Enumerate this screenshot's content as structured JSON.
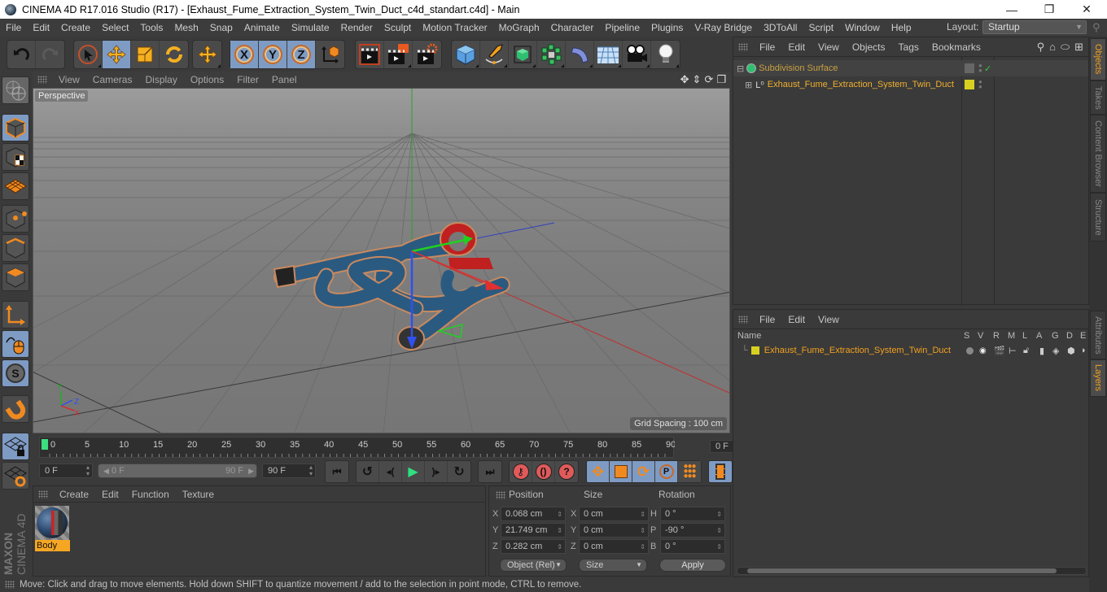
{
  "window": {
    "title": "CINEMA 4D R17.016 Studio (R17) - [Exhaust_Fume_Extraction_System_Twin_Duct_c4d_standart.c4d] - Main",
    "controls": {
      "minimize": "—",
      "maximize": "❐",
      "close": "✕"
    }
  },
  "menubar": {
    "items": [
      "File",
      "Edit",
      "Create",
      "Select",
      "Tools",
      "Mesh",
      "Snap",
      "Animate",
      "Simulate",
      "Render",
      "Sculpt",
      "Motion Tracker",
      "MoGraph",
      "Character",
      "Pipeline",
      "Plugins",
      "V-Ray Bridge",
      "3DToAll",
      "Script",
      "Window",
      "Help"
    ],
    "layout_label": "Layout:",
    "layout_value": "Startup"
  },
  "toolbar": {
    "undo": "undo-icon",
    "redo": "redo-icon",
    "tools": [
      "live-selection",
      "move",
      "scale",
      "rotate",
      "recent-tool"
    ],
    "axes": [
      "X",
      "Y",
      "Z"
    ],
    "render": [
      "render-view",
      "render-to-picture-viewer",
      "edit-render-settings"
    ],
    "objects": [
      "cube",
      "pen",
      "subdivision-surface",
      "cloner",
      "deformer",
      "floor",
      "camera",
      "light"
    ]
  },
  "viewport": {
    "menu": [
      "View",
      "Cameras",
      "Display",
      "Options",
      "Filter",
      "Panel"
    ],
    "label": "Perspective",
    "grid_spacing": "Grid Spacing : 100 cm",
    "axis_labels": {
      "x": "X",
      "y": "Y",
      "z": "Z"
    }
  },
  "timeline": {
    "ticks": [
      "0",
      "5",
      "10",
      "15",
      "20",
      "25",
      "30",
      "35",
      "40",
      "45",
      "50",
      "55",
      "60",
      "65",
      "70",
      "75",
      "80",
      "85",
      "90"
    ],
    "current_frame": "0 F",
    "start": "0 F",
    "range_start": "0 F",
    "range_end": "90 F",
    "end": "90 F"
  },
  "materials": {
    "menu": [
      "Create",
      "Edit",
      "Function",
      "Texture"
    ],
    "items": [
      {
        "name": "Body"
      }
    ]
  },
  "coordinates": {
    "headers": {
      "position": "Position",
      "size": "Size",
      "rotation": "Rotation"
    },
    "position": {
      "x": "0.068 cm",
      "y": "21.749 cm",
      "z": "0.282 cm"
    },
    "size": {
      "x": "0 cm",
      "y": "0 cm",
      "z": "0 cm"
    },
    "rotation": {
      "h": "0 °",
      "p": "-90 °",
      "b": "0 °"
    },
    "labels": {
      "x": "X",
      "y": "Y",
      "z": "Z",
      "h": "H",
      "p": "P",
      "b": "B"
    },
    "mode": "Object (Rel)",
    "size_mode": "Size",
    "apply": "Apply"
  },
  "status": "Move: Click and drag to move elements. Hold down SHIFT to quantize movement / add to the selection in point mode, CTRL to remove.",
  "objects_panel": {
    "menu": [
      "File",
      "Edit",
      "View",
      "Objects",
      "Tags",
      "Bookmarks"
    ],
    "items": [
      {
        "name": "Subdivision Surface",
        "color": "#c8a040"
      },
      {
        "name": "Exhaust_Fume_Extraction_System_Twin_Duct",
        "color": "#f0b030"
      }
    ]
  },
  "layers_panel": {
    "menu": [
      "File",
      "Edit",
      "View"
    ],
    "columns": [
      "Name",
      "S",
      "V",
      "R",
      "M",
      "L",
      "A",
      "G",
      "D",
      "E"
    ],
    "items": [
      {
        "name": "Exhaust_Fume_Extraction_System_Twin_Duct",
        "color": "#d8d020"
      }
    ]
  },
  "side_tabs": {
    "top": [
      "Objects",
      "Takes",
      "Content Browser",
      "Structure"
    ],
    "bottom": [
      "Attributes",
      "Layers"
    ]
  },
  "brand": {
    "maxon": "MAXON",
    "product": "CINEMA 4D"
  },
  "colors": {
    "accent": "#f0a020",
    "selected_blue": "#7e9bc4",
    "panel_bg": "#3a3a3a"
  }
}
